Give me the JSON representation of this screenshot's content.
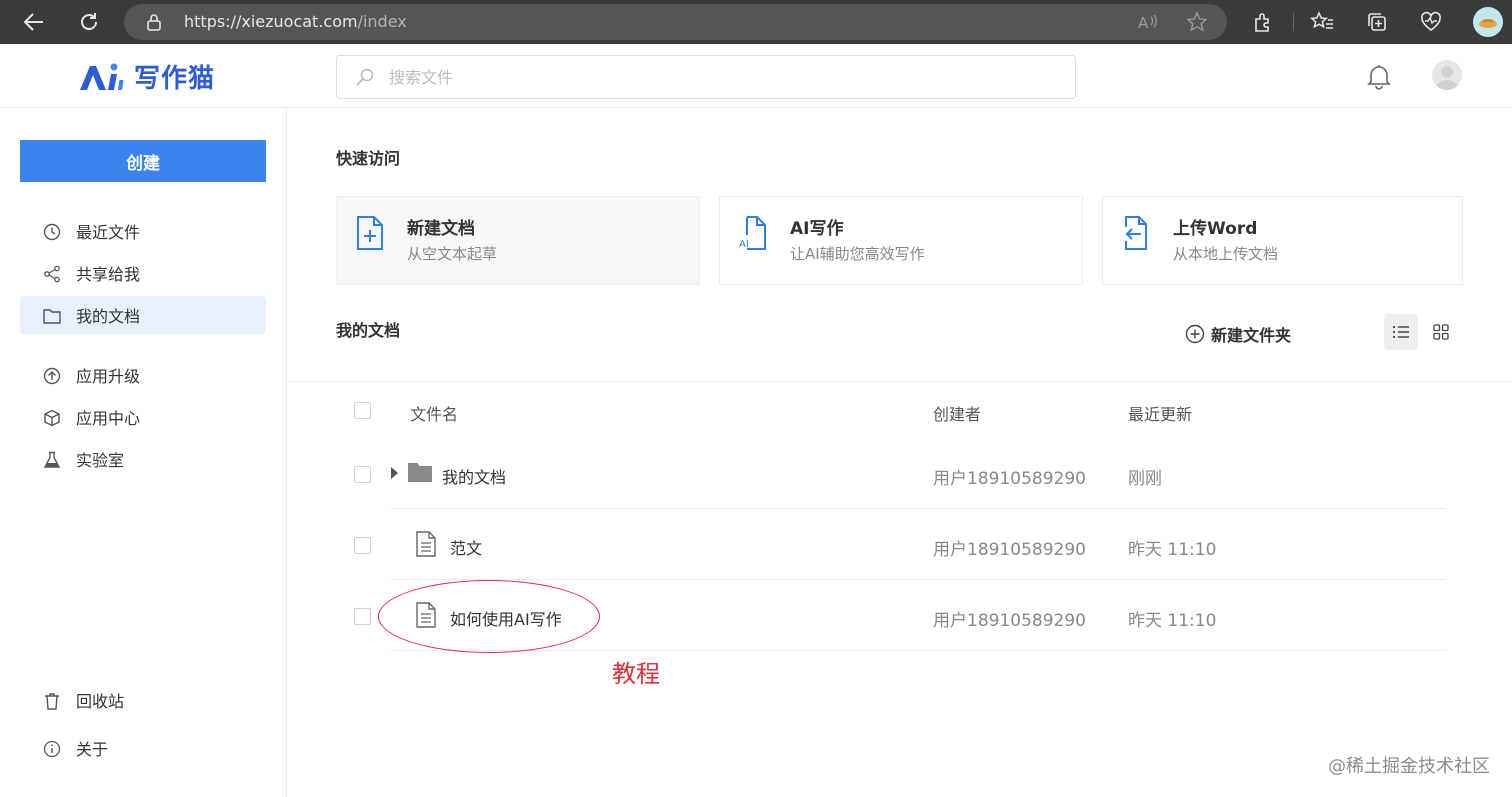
{
  "browser": {
    "url_host": "https://xiezuocat.com",
    "url_path": "/index"
  },
  "header": {
    "logo_text": "写作猫",
    "search_placeholder": "搜索文件"
  },
  "sidebar": {
    "create_label": "创建",
    "items": [
      {
        "label": "最近文件",
        "icon": "clock-icon"
      },
      {
        "label": "共享给我",
        "icon": "share-icon"
      },
      {
        "label": "我的文档",
        "icon": "folder-icon",
        "active": true
      },
      {
        "label": "应用升级",
        "icon": "upgrade-icon"
      },
      {
        "label": "应用中心",
        "icon": "cube-icon"
      },
      {
        "label": "实验室",
        "icon": "flask-icon"
      },
      {
        "label": "回收站",
        "icon": "trash-icon"
      },
      {
        "label": "关于",
        "icon": "info-icon"
      }
    ]
  },
  "quick_access": {
    "title": "快速访问",
    "cards": [
      {
        "title": "新建文档",
        "subtitle": "从空文本起草"
      },
      {
        "title": "AI写作",
        "subtitle": "让AI辅助您高效写作"
      },
      {
        "title": "上传Word",
        "subtitle": "从本地上传文档"
      }
    ]
  },
  "documents": {
    "title": "我的文档",
    "new_folder_label": "新建文件夹",
    "columns": {
      "name": "文件名",
      "creator": "创建者",
      "updated": "最近更新"
    },
    "rows": [
      {
        "type": "folder",
        "name": "我的文档",
        "creator": "用户18910589290",
        "updated": "刚刚"
      },
      {
        "type": "doc",
        "name": "范文",
        "creator": "用户18910589290",
        "updated": "昨天 11:10"
      },
      {
        "type": "doc",
        "name": "如何使用AI写作",
        "creator": "用户18910589290",
        "updated": "昨天 11:10"
      }
    ]
  },
  "annotation": {
    "text": "教程",
    "color": "#e0303a"
  },
  "watermark": "@稀土掘金技术社区",
  "colors": {
    "accent": "#3d83f0",
    "brand": "#2e5bd6",
    "active_bg": "#e7f1fd"
  }
}
